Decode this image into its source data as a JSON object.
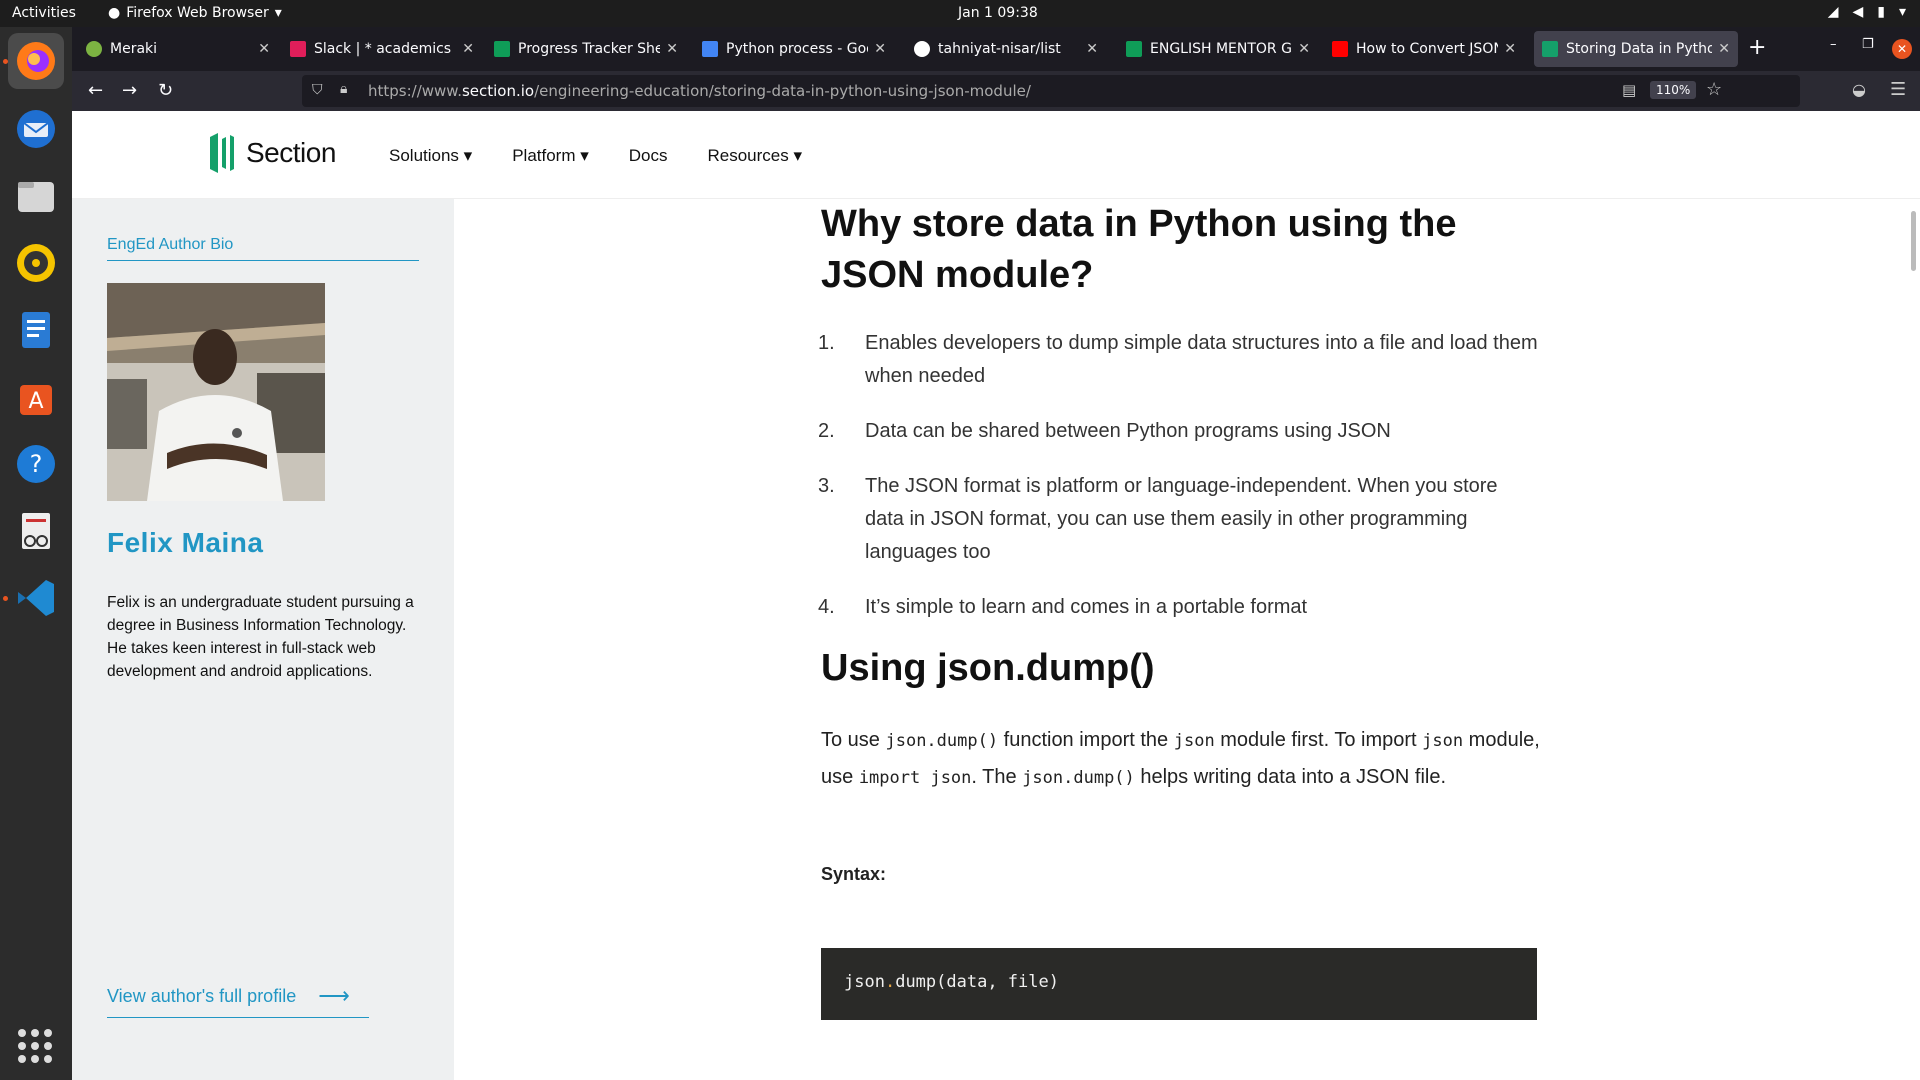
{
  "topbar": {
    "activities": "Activities",
    "app_name": "Firefox Web Browser",
    "clock": "Jan 1  09:38"
  },
  "tabs": [
    {
      "label": "Meraki",
      "favicon_color": "#7cb342",
      "left": 0
    },
    {
      "label": "Slack | * academics | N",
      "favicon_color": "#e01e5a"
    },
    {
      "label": "Progress Tracker Shee",
      "favicon_color": "#0f9d58"
    },
    {
      "label": "Python process - Goog",
      "favicon_color": "#4285f4"
    },
    {
      "label": "tahniyat-nisar/list",
      "favicon_color": "#ffffff"
    },
    {
      "label": "ENGLISH MENTOR GRO",
      "favicon_color": "#0f9d58"
    },
    {
      "label": "How to Convert JSON",
      "favicon_color": "#ff0000"
    },
    {
      "label": "Storing Data in Python",
      "favicon_color": "#15a06a"
    }
  ],
  "navbar": {
    "url_prefix": "https://www.",
    "url_host": "section.io",
    "url_path": "/engineering-education/storing-data-in-python-using-json-module/",
    "zoom": "110%"
  },
  "site": {
    "logo_text": "Section",
    "nav": [
      "Solutions ▾",
      "Platform ▾",
      "Docs",
      "Resources ▾"
    ]
  },
  "author": {
    "bio_label": "EngEd Author Bio",
    "name": "Felix Maina",
    "description": "Felix is an undergraduate student pursuing a degree in Business Information Technology. He takes keen interest in full-stack web development and android applications.",
    "profile_link": "View author's full profile"
  },
  "article": {
    "heading1": "Why store data in Python using the JSON module?",
    "reasons": [
      {
        "num": "1.",
        "text": "Enables developers to dump simple data structures into a file and load them when needed"
      },
      {
        "num": "2.",
        "text": "Data can be shared between Python programs using JSON"
      },
      {
        "num": "3.",
        "text": "The JSON format is platform or language-independent. When you store data in JSON format, you can use them easily in other programming languages too"
      },
      {
        "num": "4.",
        "text": "It’s simple to learn and comes in a portable format"
      }
    ],
    "heading2": "Using json.dump()",
    "para": {
      "t1": "To use ",
      "c1": "json.dump()",
      "t2": " function import the ",
      "c2": "json",
      "t3": " module first. To import ",
      "c3": "json",
      "t4": " module, use ",
      "c4": "import json",
      "t5": ". The ",
      "c5": "json.dump()",
      "t6": " helps writing data into a JSON file."
    },
    "syntax_label": "Syntax:",
    "code": {
      "a": "json",
      "dot": ".",
      "b": "dump(data, file)"
    }
  }
}
